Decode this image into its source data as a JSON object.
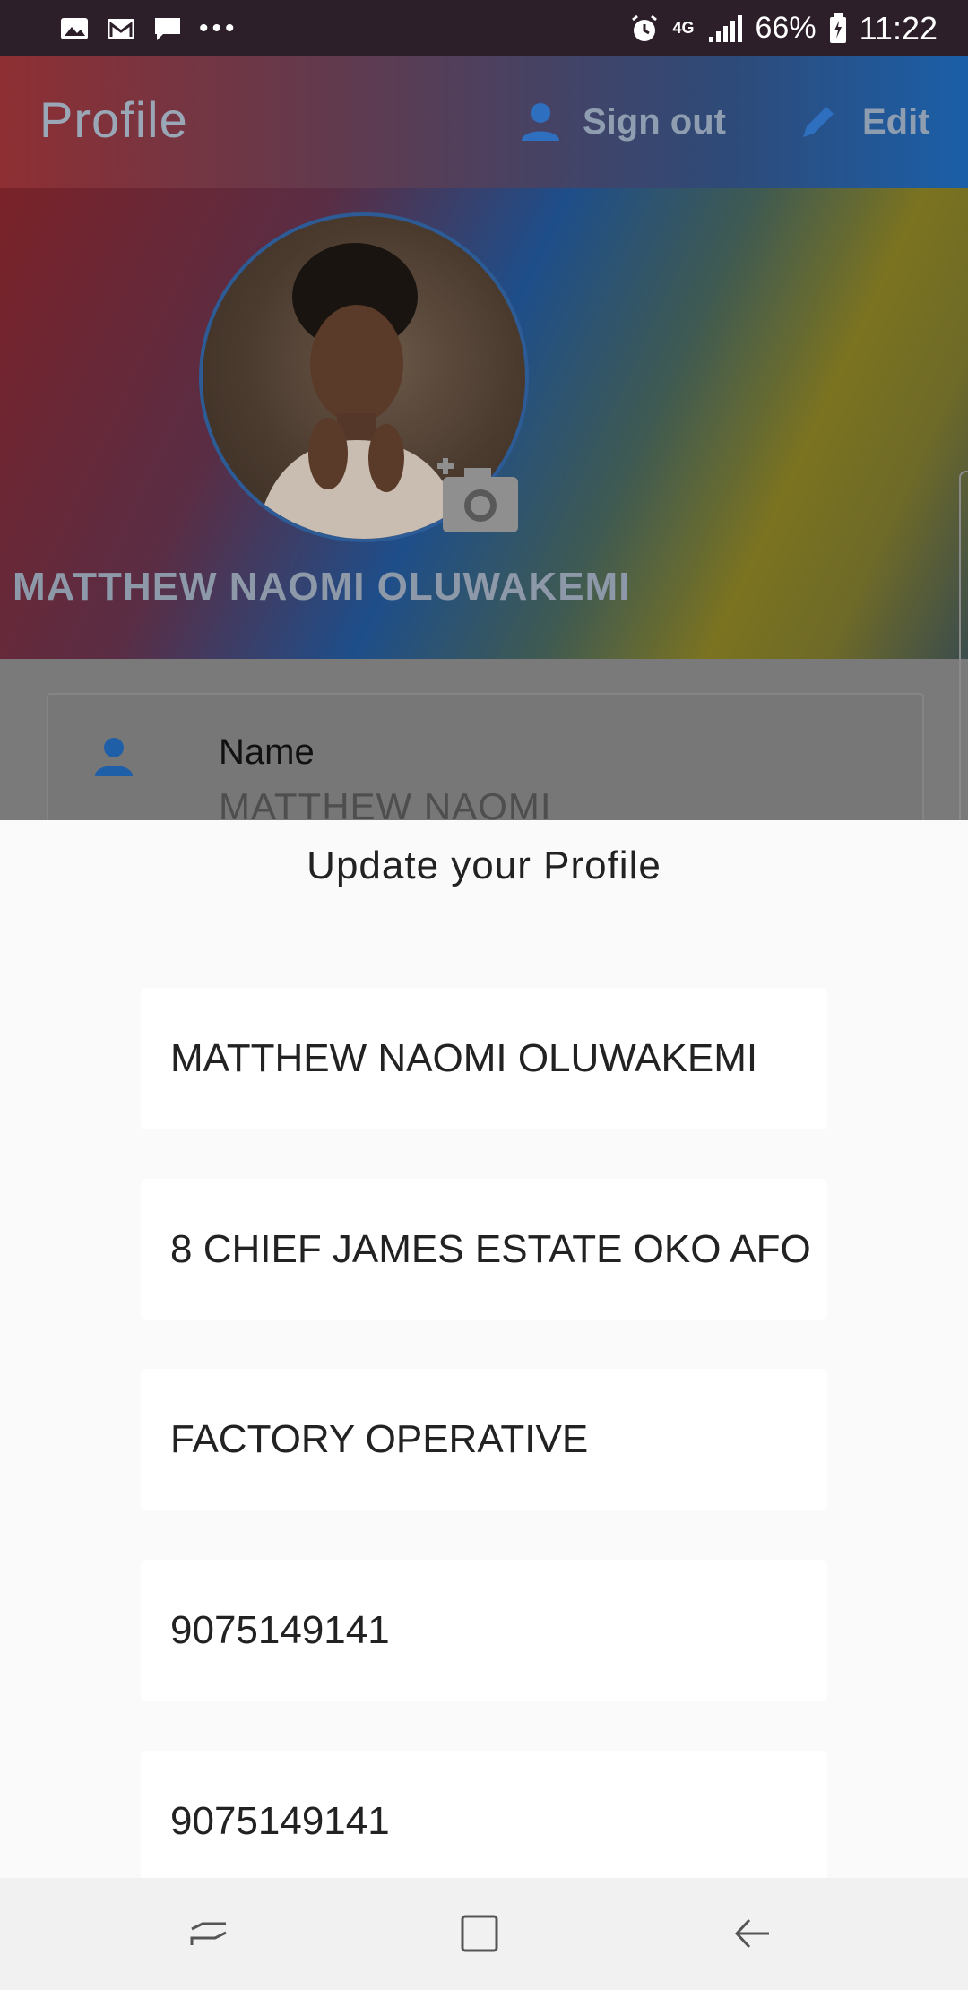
{
  "status_bar": {
    "battery": "66%",
    "time": "11:22",
    "network": "4G",
    "left_icons": [
      "gallery-icon",
      "gmail-icon",
      "message-icon",
      "more-dots-icon"
    ]
  },
  "app_bar": {
    "title": "Profile",
    "sign_out_label": "Sign out",
    "edit_label": "Edit"
  },
  "profile": {
    "display_name": "MATTHEW NAOMI OLUWAKEMI"
  },
  "name_card": {
    "label": "Name",
    "value": "MATTHEW NAOMI OLUWAKEMI"
  },
  "sheet": {
    "title": "Update your Profile",
    "fields": [
      {
        "value": "MATTHEW NAOMI OLUWAKEMI"
      },
      {
        "value": "8 CHIEF JAMES ESTATE OKO AFO"
      },
      {
        "value": "FACTORY OPERATIVE"
      },
      {
        "value": "9075149141"
      },
      {
        "value": "9075149141"
      }
    ]
  },
  "colors": {
    "accent": "#1565c0",
    "scrim": "#7a7a7a"
  }
}
